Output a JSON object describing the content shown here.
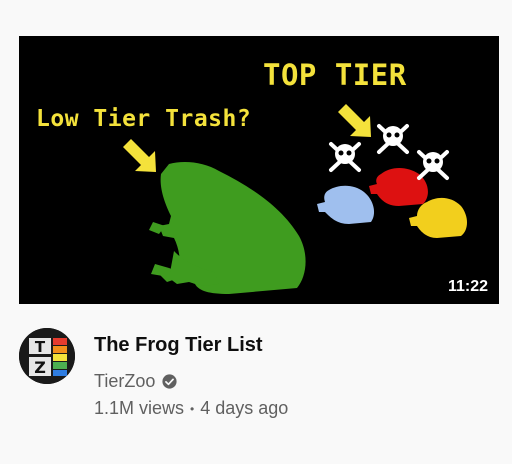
{
  "video": {
    "thumbnail": {
      "caption_low": "Low Tier Trash?",
      "caption_top": "TOP TIER",
      "duration": "11:22"
    },
    "title": "The Frog Tier List",
    "channel": {
      "name": "TierZoo",
      "avatar_letters": [
        "T",
        "Z"
      ],
      "verified_icon": "verified-check-icon"
    },
    "views": "1.1M views",
    "separator": "•",
    "uploaded": "4 days ago"
  },
  "colors": {
    "caption": "#f4e23b",
    "big_frog": "#3f9c1f",
    "blue_frog": "#9fbfee",
    "red_frog": "#dd1111",
    "yellow_frog": "#f2cf1d"
  },
  "icons": {
    "skulls": [
      "skull-crossbones-icon",
      "skull-crossbones-icon",
      "skull-crossbones-icon"
    ],
    "arrows": [
      "arrow-down-right-icon",
      "arrow-down-right-icon"
    ]
  }
}
